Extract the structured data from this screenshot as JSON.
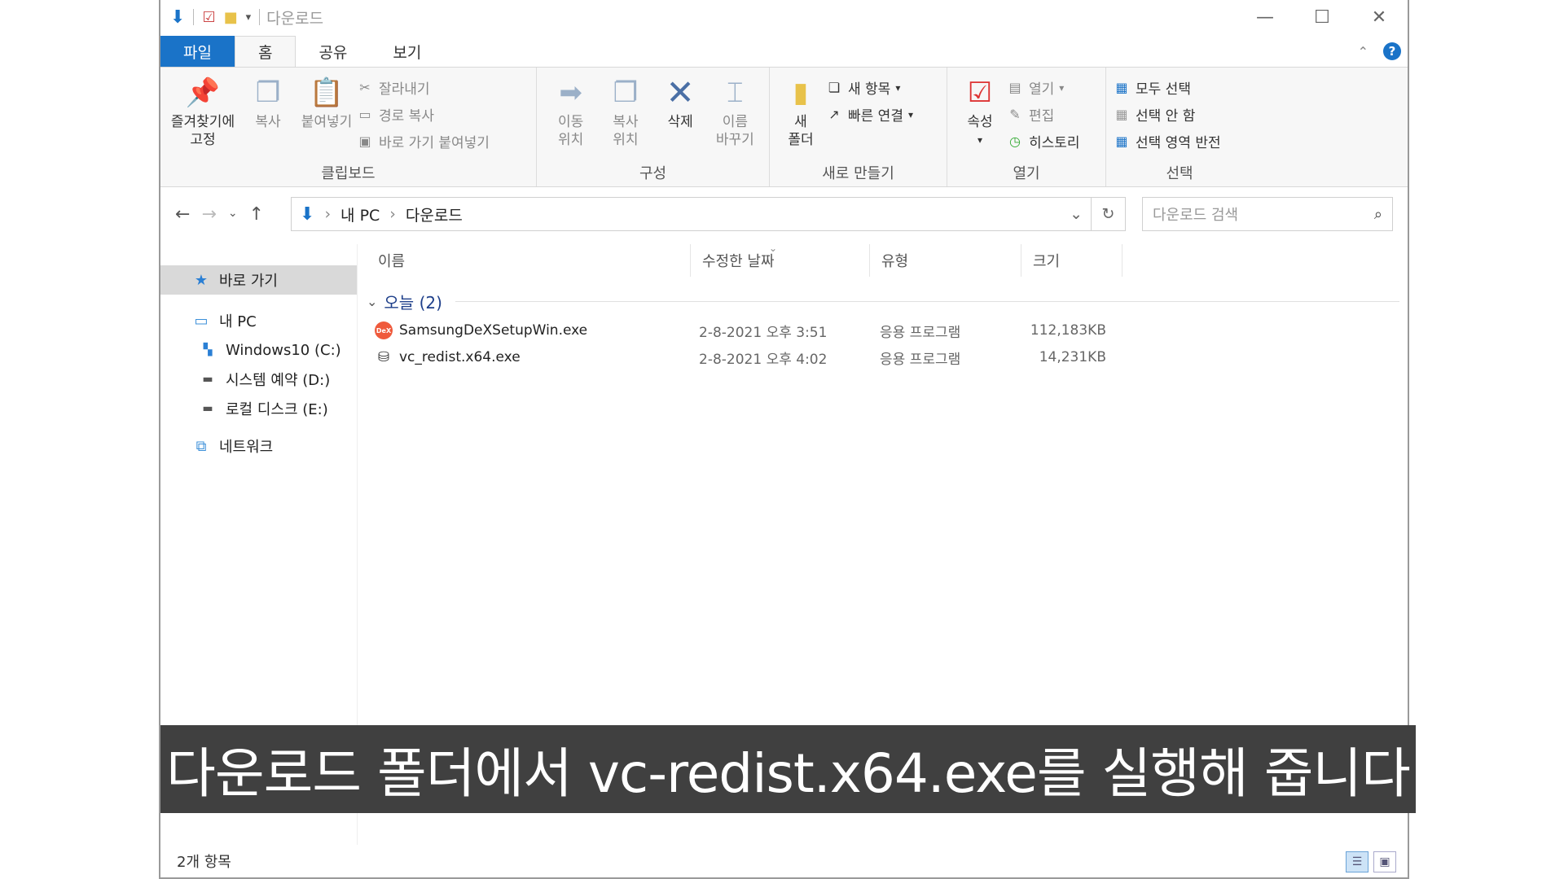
{
  "window": {
    "title": "다운로드",
    "controls": [
      "—",
      "☐",
      "✕"
    ]
  },
  "tabs": {
    "file": "파일",
    "home": "홈",
    "share": "공유",
    "view": "보기"
  },
  "ribbon": {
    "clipboard": {
      "label": "클립보드",
      "pin": "즐겨찾기에\n고정",
      "copy": "복사",
      "paste": "붙여넣기",
      "cut": "잘라내기",
      "copy_path": "경로 복사",
      "paste_shortcut": "바로 가기 붙여넣기"
    },
    "organize": {
      "label": "구성",
      "move_to": "이동\n위치",
      "copy_to": "복사\n위치",
      "delete": "삭제",
      "rename": "이름\n바꾸기"
    },
    "new": {
      "label": "새로 만들기",
      "new_folder": "새\n폴더",
      "new_item": "새 항목",
      "easy_access": "빠른 연결"
    },
    "open": {
      "label": "열기",
      "properties": "속성",
      "open": "열기",
      "edit": "편집",
      "history": "히스토리"
    },
    "select": {
      "label": "선택",
      "select_all": "모두 선택",
      "select_none": "선택 안 함",
      "invert": "선택 영역 반전"
    }
  },
  "address": {
    "crumb_pc": "내 PC",
    "crumb_downloads": "다운로드",
    "search_placeholder": "다운로드 검색"
  },
  "nav_pane": {
    "quick_access": "바로 가기",
    "this_pc": "내 PC",
    "drive_c": "Windows10 (C:)",
    "drive_d": "시스템 예약 (D:)",
    "drive_e": "로컬 디스크 (E:)",
    "network": "네트워크"
  },
  "columns": {
    "name": "이름",
    "date": "수정한 날짜",
    "type": "유형",
    "size": "크기"
  },
  "group": {
    "label": "오늘 (2)"
  },
  "files": [
    {
      "name": "SamsungDeXSetupWin.exe",
      "date": "2-8-2021 오후 3:51",
      "type": "응용 프로그램",
      "size": "112,183KB",
      "icon_text": "DeX"
    },
    {
      "name": "vc_redist.x64.exe",
      "date": "2-8-2021 오후 4:02",
      "type": "응용 프로그램",
      "size": "14,231KB"
    }
  ],
  "status": {
    "count": "2개 항목"
  },
  "caption": {
    "text": "다운로드 폴더에서 vc-redist.x64.exe를 실행해 줍니다"
  },
  "colors": {
    "accent": "#1a73c8",
    "caption_bg": "#404040",
    "group_header": "#1e3f8a"
  }
}
